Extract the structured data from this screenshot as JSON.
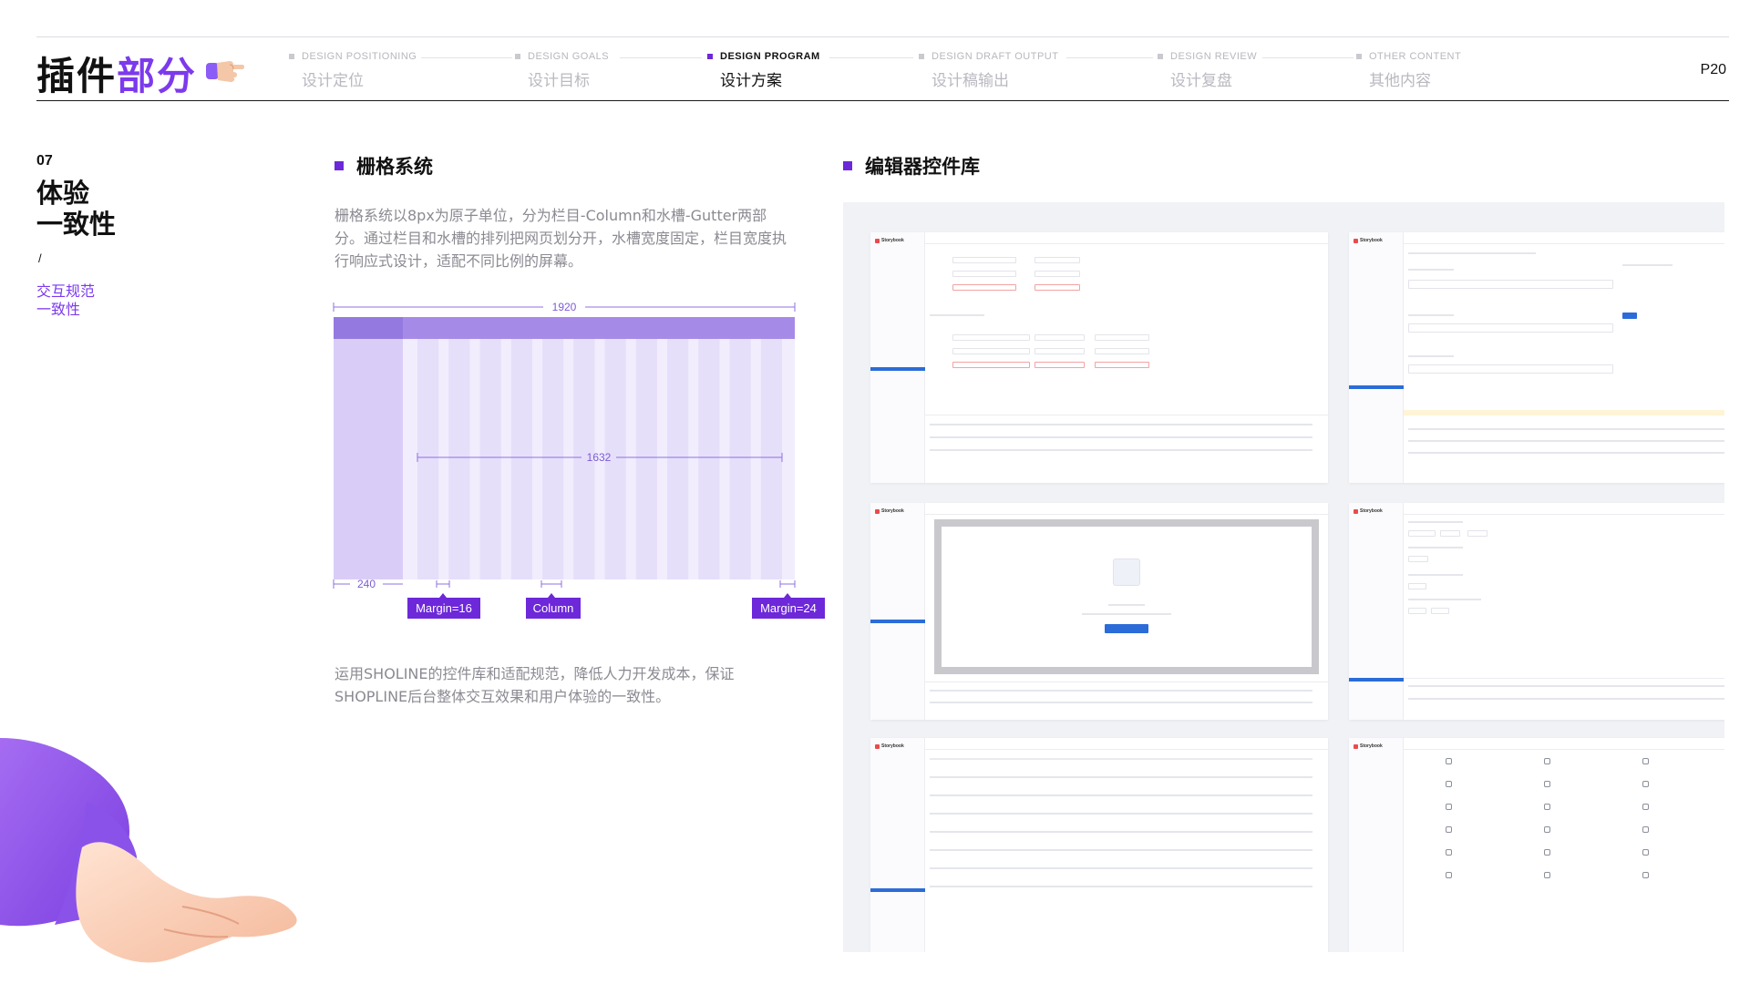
{
  "header": {
    "title_part1": "插件",
    "title_part2": "部分",
    "page_number": "P20",
    "nav": [
      {
        "en": "DESIGN POSITIONING",
        "zh": "设计定位",
        "active": false
      },
      {
        "en": "DESIGN GOALS",
        "zh": "设计目标",
        "active": false
      },
      {
        "en": "DESIGN PROGRAM",
        "zh": "设计方案",
        "active": true
      },
      {
        "en": "DESIGN DRAFT OUTPUT",
        "zh": "设计稿输出",
        "active": false
      },
      {
        "en": "DESIGN REVIEW",
        "zh": "设计复盘",
        "active": false
      },
      {
        "en": "OTHER CONTENT",
        "zh": "其他内容",
        "active": false
      }
    ]
  },
  "section": {
    "number": "07",
    "title_line1": "体验",
    "title_line2": "一致性",
    "slash": "/",
    "subtitle_line1": "交互规范",
    "subtitle_line2": "一致性"
  },
  "grid_system": {
    "heading": "栅格系统",
    "description": "栅格系统以8px为原子单位，分为栏目-Column和水槽-Gutter两部分。通过栏目和水槽的排列把网页划分开，水槽宽度固定，栏目宽度执行响应式设计，适配不同比例的屏幕。",
    "diagram": {
      "total_width_label": "1920",
      "content_width_label": "1632",
      "sidebar_width_label": "240",
      "tags": [
        "Margin=16",
        "Column",
        "Margin=24"
      ]
    },
    "note": "运用SHOLINE的控件库和适配规范，降低人力开发成本，保证SHOPLINE后台整体交互效果和用户体验的一致性。"
  },
  "editor_library": {
    "heading": "编辑器控件库",
    "logo_text": "Storybook"
  },
  "colors": {
    "accent": "#7c3aed",
    "grid_column": "#e6dffa",
    "grid_header": "#a68ae8",
    "grid_sidebar": "#d9cdf7",
    "selection_blue": "#2b6cd8"
  }
}
